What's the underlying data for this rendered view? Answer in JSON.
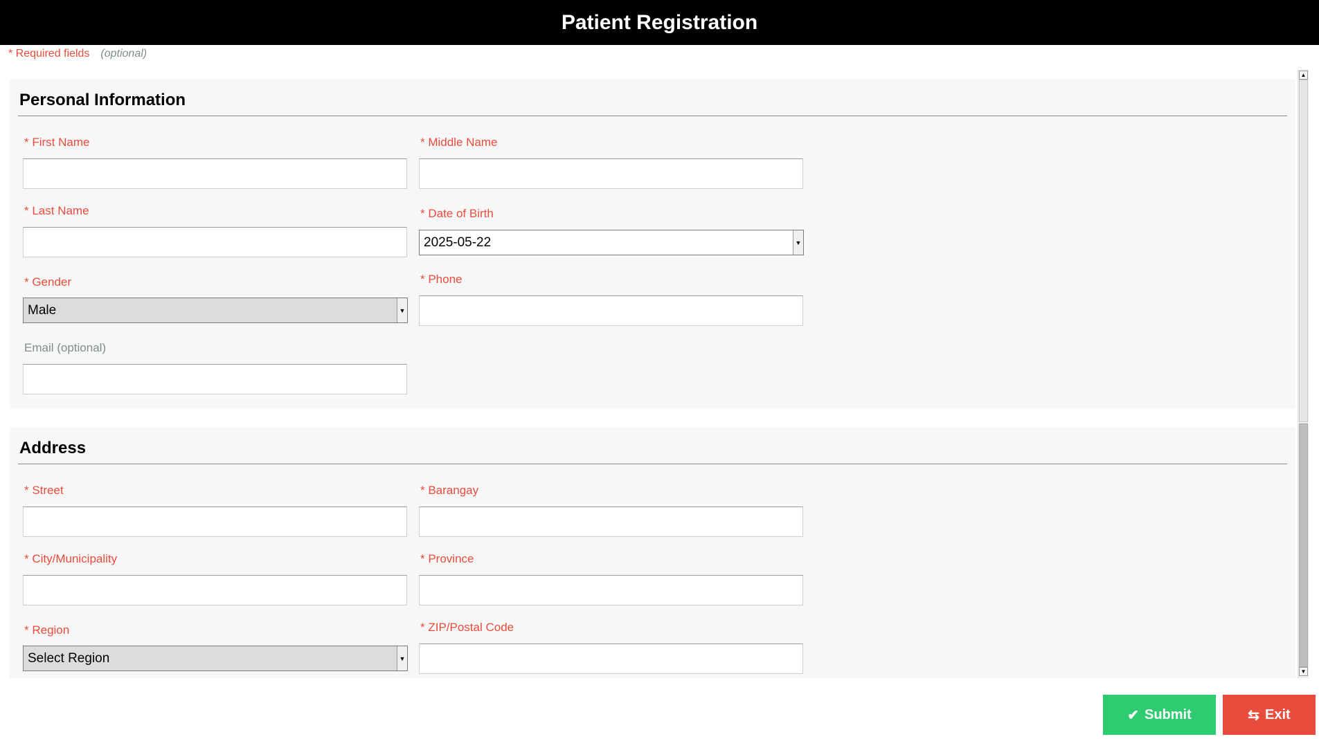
{
  "header": {
    "title": "Patient Registration"
  },
  "legend": {
    "required": "* Required fields",
    "optional": "(optional)"
  },
  "personal": {
    "heading": "Personal Information",
    "first_name": {
      "label": "* First Name",
      "value": ""
    },
    "middle_name": {
      "label": "* Middle Name",
      "value": ""
    },
    "last_name": {
      "label": "* Last Name",
      "value": ""
    },
    "dob": {
      "label": "* Date of Birth",
      "value": "2025-05-22"
    },
    "gender": {
      "label": "* Gender",
      "value": "Male"
    },
    "phone": {
      "label": "* Phone",
      "value": ""
    },
    "email": {
      "label": "Email (optional)",
      "value": ""
    }
  },
  "address": {
    "heading": "Address",
    "street": {
      "label": "* Street",
      "value": ""
    },
    "barangay": {
      "label": "* Barangay",
      "value": ""
    },
    "city": {
      "label": "* City/Municipality",
      "value": ""
    },
    "province": {
      "label": "* Province",
      "value": ""
    },
    "region": {
      "label": "* Region",
      "value": "Select Region"
    },
    "zip": {
      "label": "* ZIP/Postal Code",
      "value": ""
    }
  },
  "actions": {
    "submit": "Submit",
    "exit": "Exit"
  },
  "icons": {
    "submit": "check-icon",
    "exit": "exit-icon",
    "dropdown": "chevron-down-icon"
  },
  "colors": {
    "required": "#e74c3c",
    "optional": "#7f8c8d",
    "submit": "#2ecc71",
    "exit": "#e74c3c",
    "header": "#000000"
  }
}
